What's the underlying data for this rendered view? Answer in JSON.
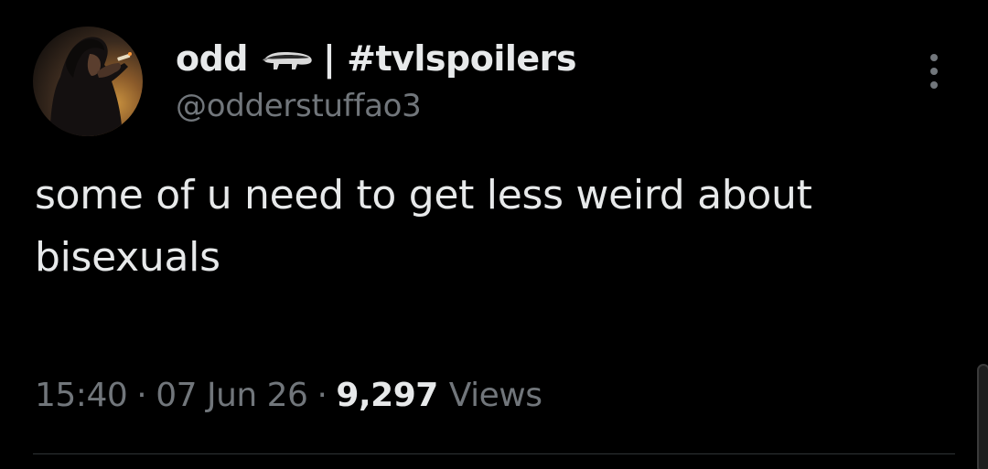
{
  "tweet": {
    "display_name": "odd",
    "name_suffix": "| #tvlspoilers",
    "name_emoji": "badger-icon",
    "handle": "@odderstuffao3",
    "text": "some of u need to get less weird about bisexuals",
    "time": "15:40",
    "date": "07 Jun 26",
    "separator": "·",
    "views_count": "9,297",
    "views_label": "Views"
  },
  "colors": {
    "background": "#000000",
    "primary_text": "#e7e9ea",
    "secondary_text": "#71767b",
    "divider": "#2f3336"
  }
}
